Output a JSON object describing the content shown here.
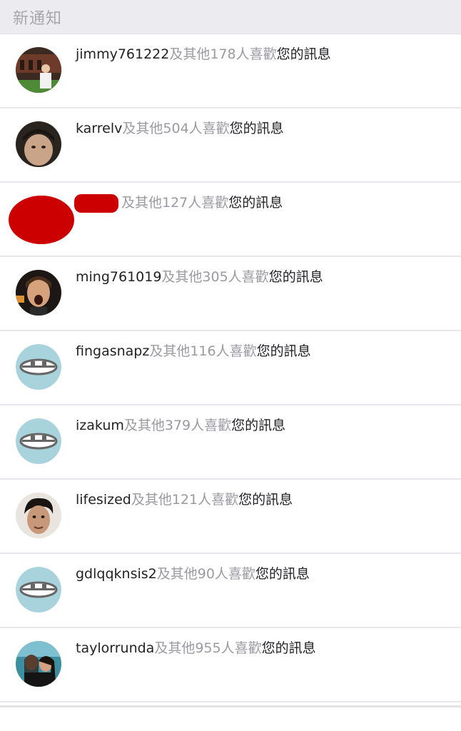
{
  "header": {
    "title": "新通知"
  },
  "notifications": [
    {
      "user": "jimmy761222",
      "middle": "及其他178人喜歡",
      "suffix": "您的訊息",
      "avatar": "photo-building"
    },
    {
      "user": "karrelv",
      "middle": "及其他504人喜歡",
      "suffix": "您的訊息",
      "avatar": "photo-face-dark"
    },
    {
      "user": "",
      "middle": "及其他127人喜歡",
      "suffix": "您的訊息",
      "avatar": "redacted"
    },
    {
      "user": "ming761019",
      "middle": "及其他305人喜歡",
      "suffix": "您的訊息",
      "avatar": "photo-face-open-mouth"
    },
    {
      "user": "fingasnapz",
      "middle": "及其他116人喜歡",
      "suffix": "您的訊息",
      "avatar": "default-eyes-icon"
    },
    {
      "user": "izakum",
      "middle": "及其他379人喜歡",
      "suffix": "您的訊息",
      "avatar": "default-eyes-icon"
    },
    {
      "user": "lifesized",
      "middle": "及其他121人喜歡",
      "suffix": "您的訊息",
      "avatar": "photo-face-curly"
    },
    {
      "user": "gdlqqknsis2",
      "middle": "及其他90人喜歡",
      "suffix": "您的訊息",
      "avatar": "default-eyes-icon"
    },
    {
      "user": "taylorrunda",
      "middle": "及其他955人喜歡",
      "suffix": "您的訊息",
      "avatar": "photo-couple"
    }
  ],
  "colors": {
    "header_bg": "#ececf0",
    "muted_text": "#9a9aa0",
    "default_avatar_bg": "#a9d3dc",
    "redaction": "#cc0000"
  }
}
